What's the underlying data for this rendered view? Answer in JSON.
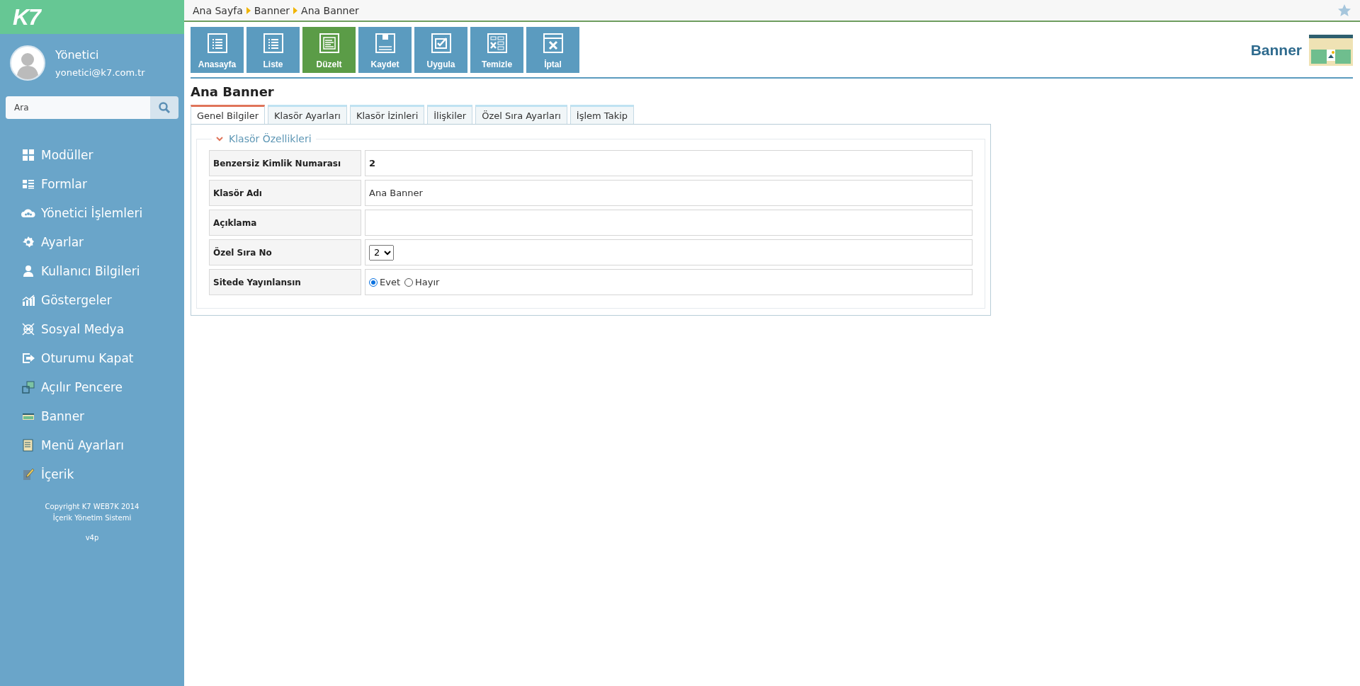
{
  "logo": "K7",
  "user": {
    "name": "Yönetici",
    "email": "yonetici@k7.com.tr"
  },
  "search": {
    "placeholder": "Ara"
  },
  "menu": [
    {
      "label": "Modüller",
      "kind": "grid"
    },
    {
      "label": "Formlar",
      "kind": "form"
    },
    {
      "label": "Yönetici İşlemleri",
      "kind": "cloud"
    },
    {
      "label": "Ayarlar",
      "kind": "gear"
    },
    {
      "label": "Kullanıcı Bilgileri",
      "kind": "user"
    },
    {
      "label": "Göstergeler",
      "kind": "chart"
    },
    {
      "label": "Sosyal Medya",
      "kind": "globe"
    },
    {
      "label": "Oturumu Kapat",
      "kind": "exit"
    },
    {
      "label": "Açılır Pencere",
      "kind": "window"
    },
    {
      "label": "Banner",
      "kind": "banner"
    },
    {
      "label": "Menü Ayarları",
      "kind": "doc"
    },
    {
      "label": "İçerik",
      "kind": "pencil"
    }
  ],
  "footer": {
    "lines": [
      "Copyright K7 WEB7K 2014",
      "İçerik Yönetim Sistemi"
    ],
    "version": "v4p"
  },
  "breadcrumb": [
    "Ana Sayfa",
    "Banner",
    "Ana Banner"
  ],
  "toolbar": [
    {
      "label": "Anasayfa",
      "kind": "list",
      "selected": false
    },
    {
      "label": "Liste",
      "kind": "list",
      "selected": false
    },
    {
      "label": "Düzelt",
      "kind": "edit",
      "selected": true
    },
    {
      "label": "Kaydet",
      "kind": "save",
      "selected": false
    },
    {
      "label": "Uygula",
      "kind": "check",
      "selected": false
    },
    {
      "label": "Temizle",
      "kind": "clear",
      "selected": false
    },
    {
      "label": "İptal",
      "kind": "cancel",
      "selected": false
    }
  ],
  "module_title": "Banner",
  "page_title": "Ana Banner",
  "tabs": [
    {
      "label": "Genel Bilgiler",
      "selected": true
    },
    {
      "label": "Klasör Ayarları",
      "selected": false
    },
    {
      "label": "Klasör İzinleri",
      "selected": false
    },
    {
      "label": "İlişkiler",
      "selected": false
    },
    {
      "label": "Özel Sıra Ayarları",
      "selected": false
    },
    {
      "label": "İşlem Takip",
      "selected": false
    }
  ],
  "section": {
    "title": "Klasör Özellikleri",
    "expanded": true
  },
  "fields": [
    {
      "label": "Benzersiz Kimlik Numarası",
      "kind": "static",
      "value": "2"
    },
    {
      "label": "Klasör Adı",
      "kind": "text",
      "value": "Ana Banner"
    },
    {
      "label": "Açıklama",
      "kind": "text"
    },
    {
      "label": "Özel Sıra No",
      "kind": "select",
      "value": "2"
    },
    {
      "label": "Sitede Yayınlansın",
      "kind": "radio",
      "options": [
        {
          "label": "Evet",
          "selected": true
        },
        {
          "label": "Hayır",
          "selected": false
        }
      ]
    }
  ]
}
